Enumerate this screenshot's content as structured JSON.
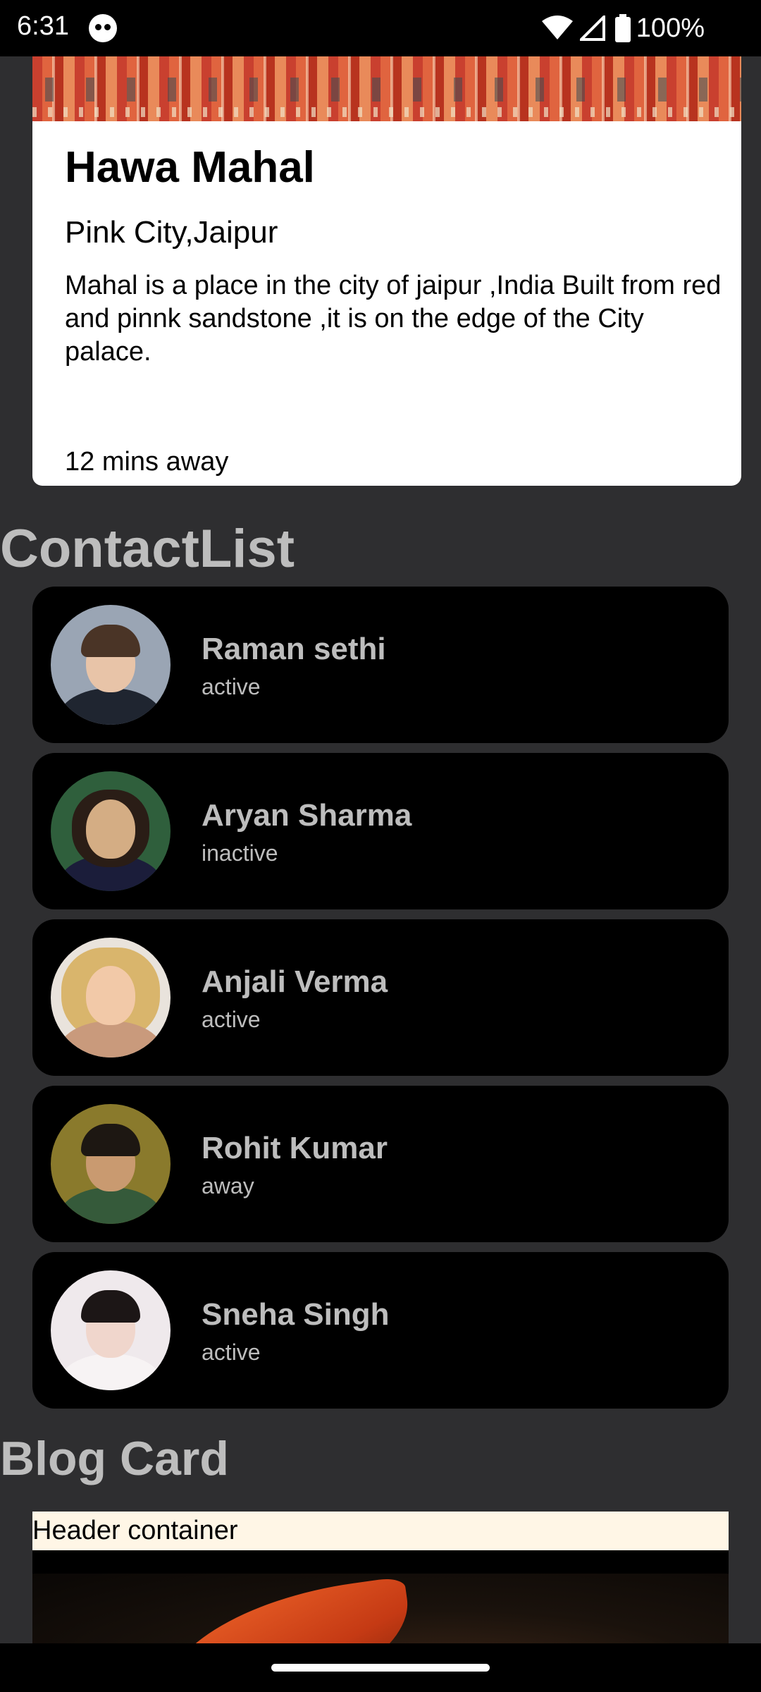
{
  "status_bar": {
    "time": "6:31",
    "battery": "100%"
  },
  "place_card": {
    "title": "Hawa Mahal",
    "subtitle": "Pink City,Jaipur",
    "description": "Mahal is a place in the city of jaipur ,India Built from red and pinnk sandstone ,it is on the edge of the City palace.",
    "distance": "12 mins away"
  },
  "contact_list": {
    "heading": "ContactList",
    "contacts": [
      {
        "name": "Raman sethi",
        "status": "active"
      },
      {
        "name": "Aryan Sharma",
        "status": "inactive"
      },
      {
        "name": "Anjali Verma",
        "status": "active"
      },
      {
        "name": "Rohit Kumar",
        "status": "away"
      },
      {
        "name": "Sneha Singh",
        "status": "active"
      }
    ]
  },
  "blog_card": {
    "heading": "Blog Card",
    "header_label": "Header container"
  },
  "colors": {
    "background": "#2e2e30",
    "card_dark": "#000000",
    "heading_text": "#bdbdbd",
    "header_bar": "#fff6e6"
  }
}
